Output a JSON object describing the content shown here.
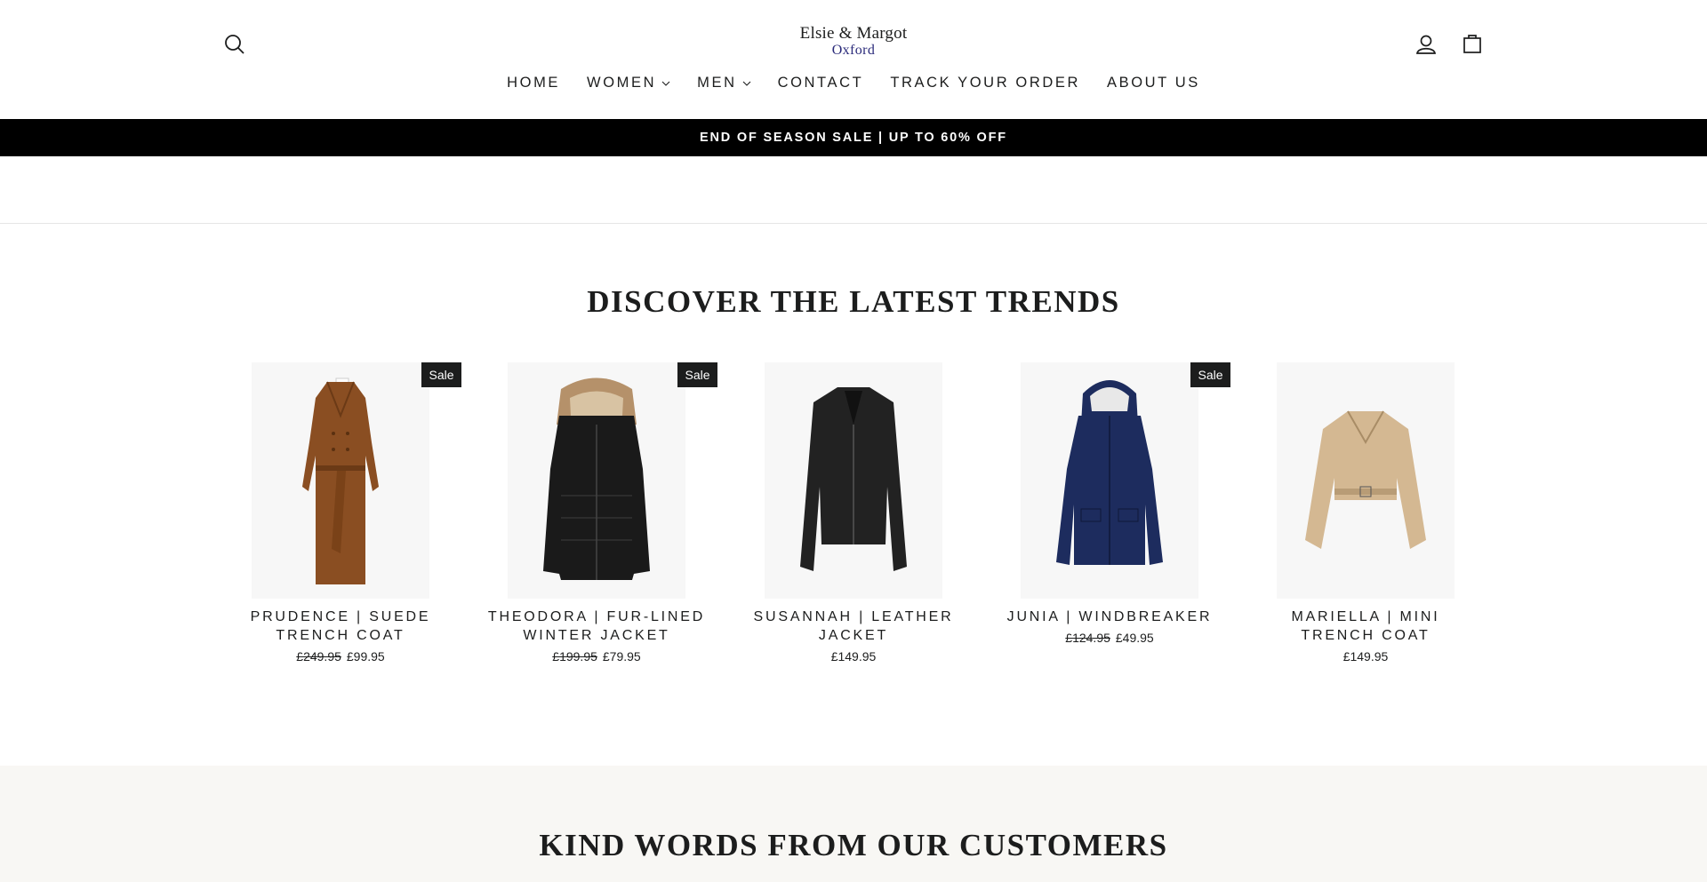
{
  "header": {
    "logo_line1": "Elsie & Margot",
    "logo_line2": "Oxford",
    "icons": [
      "search-icon",
      "user-icon",
      "bag-icon"
    ]
  },
  "nav": [
    {
      "label": "HOME"
    },
    {
      "label": "WOMEN"
    },
    {
      "label": "MEN"
    },
    {
      "label": "CONTACT"
    },
    {
      "label": "TRACK YOUR ORDER"
    },
    {
      "label": "ABOUT US"
    }
  ],
  "announcement": "END OF SEASON SALE | UP TO 60% OFF",
  "trends": {
    "title": "DISCOVER THE LATEST TRENDS",
    "products": [
      {
        "name": "PRUDENCE | SUEDE TRENCH COAT",
        "old_price": "£249.95",
        "price": "£99.95",
        "badge": "Sale"
      },
      {
        "name": "THEODORA | FUR-LINED WINTER JACKET",
        "old_price": "£199.95",
        "price": "£79.95",
        "badge": "Sale"
      },
      {
        "name": "SUSANNAH | LEATHER JACKET",
        "old_price": "",
        "price": "£149.95",
        "badge": ""
      },
      {
        "name": "JUNIA | WINDBREAKER",
        "old_price": "£124.95",
        "price": "£49.95",
        "badge": "Sale"
      },
      {
        "name": "MARIELLA | MINI TRENCH COAT",
        "old_price": "",
        "price": "£149.95",
        "badge": ""
      }
    ]
  },
  "testimonials": {
    "title": "KIND WORDS FROM OUR CUSTOMERS"
  },
  "colors": {
    "announcement_bg": "#000000",
    "text": "#1c1d1d",
    "badge_bg": "#1c1d1d",
    "testimonial_bg": "#f8f7f4"
  }
}
